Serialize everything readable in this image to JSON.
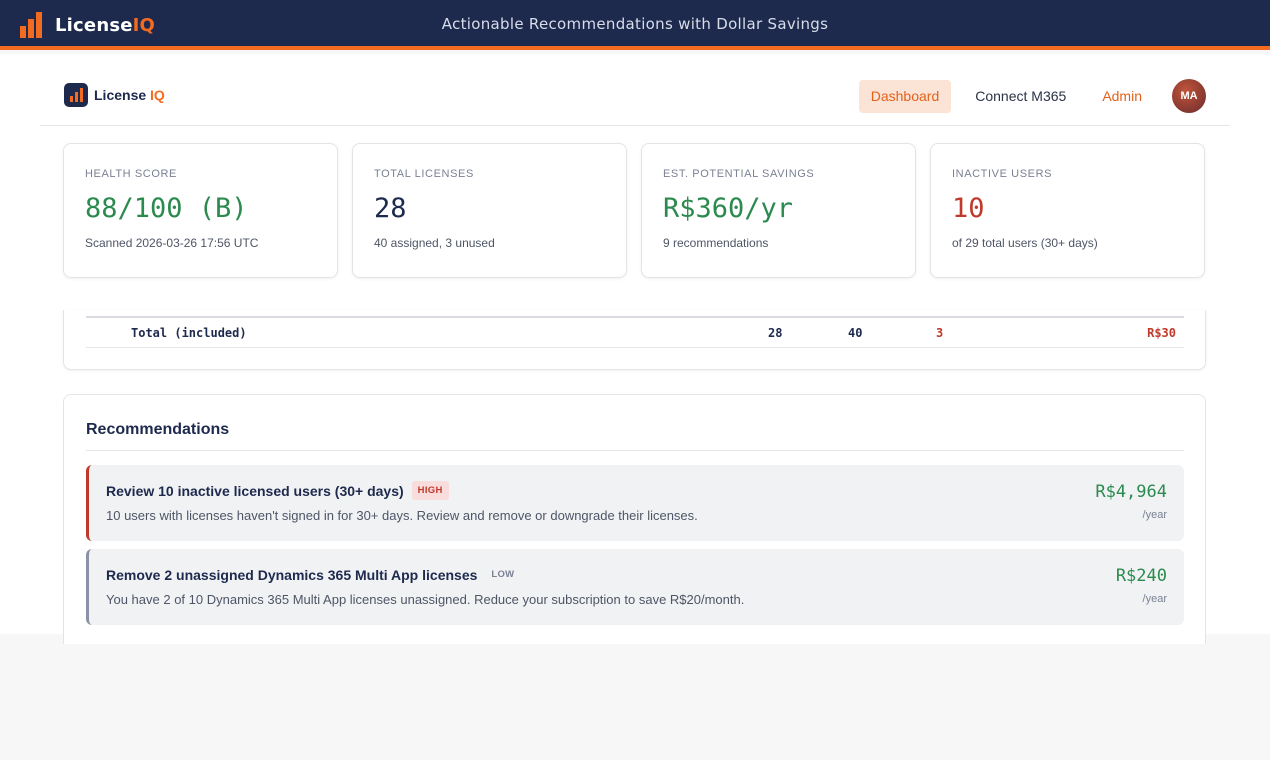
{
  "header": {
    "logo_main": "License",
    "logo_accent": "IQ",
    "title": "Actionable Recommendations with Dollar Savings"
  },
  "nav": {
    "logo_main": "License ",
    "logo_accent": "IQ",
    "links": [
      "Dashboard",
      "Connect M365",
      "Admin"
    ],
    "active": "Dashboard",
    "avatar_initials": "MA"
  },
  "stats": [
    {
      "label": "HEALTH SCORE",
      "value": "88/100 (B)",
      "sub": "Scanned 2026-03-26 17:56 UTC",
      "color": "#2b8a4e"
    },
    {
      "label": "TOTAL LICENSES",
      "value": "28",
      "sub": "40 assigned, 3 unused",
      "color": "#1d2a4d"
    },
    {
      "label": "EST. POTENTIAL SAVINGS",
      "value": "R$360/yr",
      "sub": "9 recommendations",
      "color": "#2b8a4e"
    },
    {
      "label": "INACTIVE USERS",
      "value": "10",
      "sub": "of 29 total users (30+ days)",
      "color": "#c0392b"
    }
  ],
  "licenses_table": {
    "total_row": {
      "label": "Total (included)",
      "total": "28",
      "assigned": "40",
      "unused": "3",
      "cost": "R$30"
    }
  },
  "recommendations": {
    "title": "Recommendations",
    "items": [
      {
        "title": "Review 10 inactive licensed users (30+ days)",
        "priority": "HIGH",
        "description": "10 users with licenses haven't signed in for 30+ days. Review and remove or downgrade their licenses.",
        "amount": "R$4,964",
        "period": "/year"
      },
      {
        "title": "Remove 2 unassigned Dynamics 365 Multi App licenses",
        "priority": "LOW",
        "description": "You have 2 of 10 Dynamics 365 Multi App licenses unassigned. Reduce your subscription to save R$20/month.",
        "amount": "R$240",
        "period": "/year"
      }
    ]
  },
  "colors": {
    "brand_navy": "#1d2a4d",
    "brand_orange": "#f26b21",
    "positive": "#2b8a4e",
    "negative": "#c0392b"
  }
}
